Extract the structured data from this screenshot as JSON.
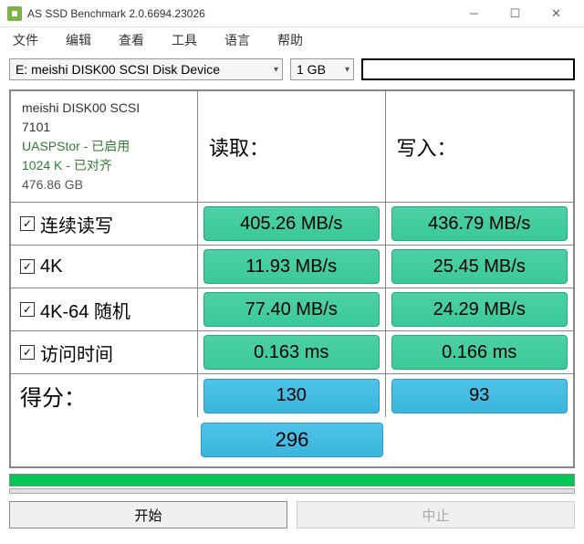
{
  "window": {
    "title": "AS SSD Benchmark 2.0.6694.23026"
  },
  "menu": {
    "file": "文件",
    "edit": "编辑",
    "view": "查看",
    "tools": "工具",
    "language": "语言",
    "help": "帮助"
  },
  "toolbar": {
    "disk_selector": "E: meishi DISK00 SCSI Disk Device",
    "size_selector": "1 GB"
  },
  "info": {
    "name": "meishi DISK00 SCSI",
    "number": "7101",
    "uasp": "UASPStor - 已启用",
    "alignment": "1024 K - 已对齐",
    "capacity": "476.86 GB"
  },
  "headers": {
    "read": "读取：",
    "write": "写入："
  },
  "rows": {
    "seq": {
      "label": "连续读写",
      "checked": true,
      "read": "405.26 MB/s",
      "write": "436.79 MB/s"
    },
    "k4": {
      "label": "4K",
      "checked": true,
      "read": "11.93 MB/s",
      "write": "25.45 MB/s"
    },
    "k4_64": {
      "label": "4K-64 随机",
      "checked": true,
      "read": "77.40 MB/s",
      "write": "24.29 MB/s"
    },
    "access": {
      "label": "访问时间",
      "checked": true,
      "read": "0.163 ms",
      "write": "0.166 ms"
    }
  },
  "score": {
    "label": "得分：",
    "read": "130",
    "write": "93",
    "total": "296"
  },
  "buttons": {
    "start": "开始",
    "abort": "中止"
  }
}
